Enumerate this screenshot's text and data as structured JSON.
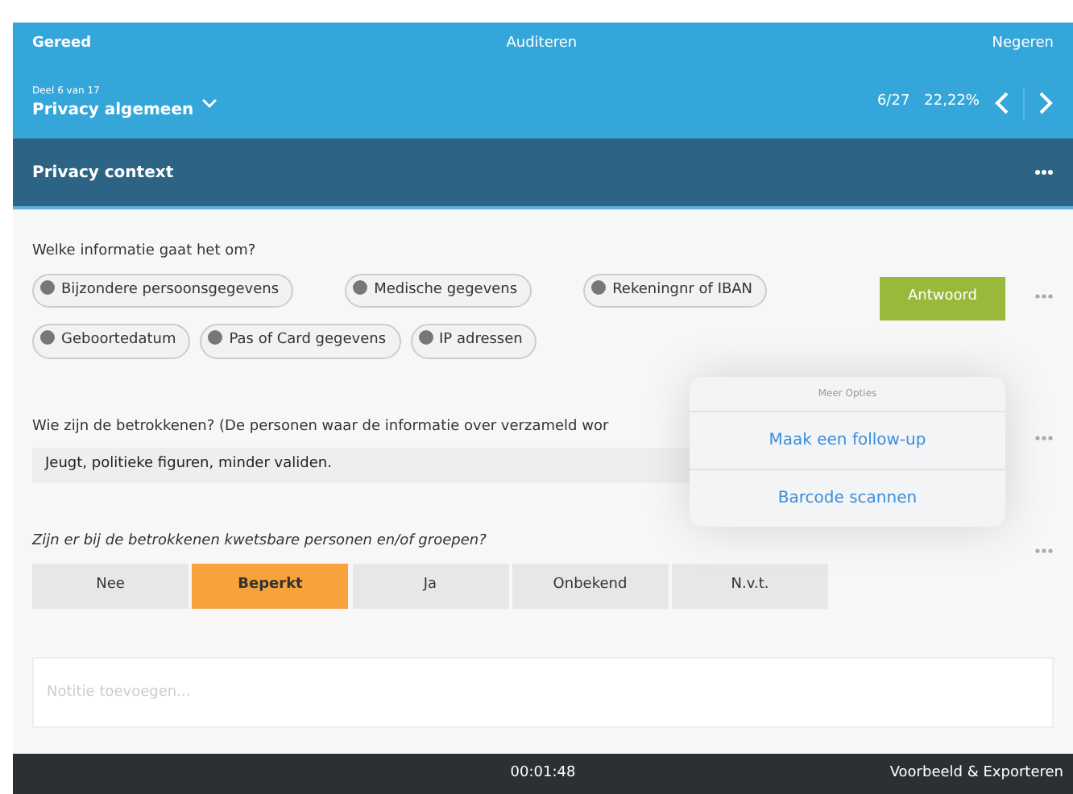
{
  "top_bar": {
    "left": "Gereed",
    "title": "Auditeren",
    "right": "Negeren"
  },
  "nav_bar": {
    "part": "Deel 6 van 17",
    "section": "Privacy algemeen",
    "count": "6/27",
    "percent": "22,22%"
  },
  "section": {
    "title": "Privacy context"
  },
  "questions": [
    {
      "kind": "chips",
      "label": "Welke informatie gaat het om?",
      "button": "Antwoord",
      "options": [
        {
          "label": "Bijzondere persoonsgegevens",
          "selected": false
        },
        {
          "label": "Medische gegevens",
          "selected": false
        },
        {
          "label": "Rekeningnr of IBAN",
          "selected": false
        },
        {
          "label": "Geboortedatum",
          "selected": false
        },
        {
          "label": "Pas of Card gegevens",
          "selected": false
        },
        {
          "label": "IP adressen",
          "selected": false
        }
      ]
    },
    {
      "kind": "text",
      "label": "Wie zijn de betrokkenen? (De personen waar de informatie over verzameld wor",
      "value": "Jeugt, politieke figuren, minder validen."
    },
    {
      "kind": "segments",
      "label": "Zijn er bij de betrokkenen kwetsbare personen en/of groepen?",
      "options": [
        {
          "label": "Nee",
          "selected": false
        },
        {
          "label": "Beperkt",
          "selected": true
        },
        {
          "label": "Ja",
          "selected": false
        },
        {
          "label": "Onbekend",
          "selected": false
        },
        {
          "label": "N.v.t.",
          "selected": false
        }
      ]
    }
  ],
  "note": {
    "placeholder": "Notitie toevoegen..."
  },
  "popover": {
    "title": "Meer Opties",
    "items": [
      "Maak een follow-up",
      "Barcode scannen"
    ]
  },
  "footer": {
    "timer": "00:01:48",
    "action": "Voorbeeld & Exporteren"
  }
}
